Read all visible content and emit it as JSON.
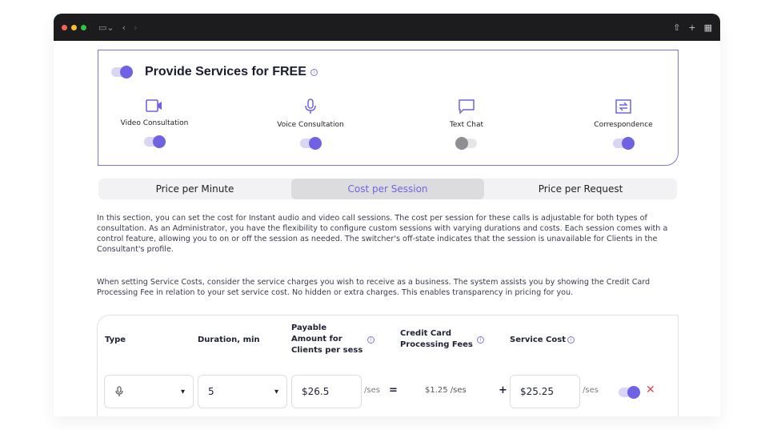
{
  "free": {
    "title": "Provide Services for FREE"
  },
  "services": [
    {
      "label": "Video Consultation",
      "enabled": true
    },
    {
      "label": "Voice Consultation",
      "enabled": true
    },
    {
      "label": "Text Chat",
      "enabled": false
    },
    {
      "label": "Correspondence",
      "enabled": true
    }
  ],
  "tabs": [
    "Price per Minute",
    "Cost per Session",
    "Price per Request"
  ],
  "active_tab": "Cost per Session",
  "paragraphs": [
    "In this section, you can set the cost for Instant audio and video call sessions. The cost per session for these calls is adjustable for both types of consultation. As an Administrator, you have the flexibility to configure custom sessions with varying durations and costs. Each session comes with a control feature, allowing you to on or off the session as needed. The switcher's off-state indicates that the session is unavailable for Clients in the Consultant's profile.",
    "When setting Service Costs, consider the service charges you wish to receive as a business. The system assists you by showing the Credit Card Processing Fee in relation to your set service cost. No hidden or extra charges. This enables transparency in pricing for you."
  ],
  "table": {
    "headers": {
      "type": "Type",
      "duration": "Duration, min",
      "payable": "Payable Amount for Clients per sess",
      "fees": "Credit Card Processing Fees",
      "cost": "Service Cost"
    },
    "row": {
      "type_icon": "microphone-icon",
      "duration": "5",
      "payable": "$26.5",
      "payable_suffix": "/ses",
      "equals": "=",
      "fee": "$1.25 /ses",
      "plus": "+",
      "cost": "$25.25",
      "cost_suffix": "/ses",
      "enabled": true
    }
  },
  "colors": {
    "accent": "#6f63e3",
    "border": "#7f75d8"
  }
}
